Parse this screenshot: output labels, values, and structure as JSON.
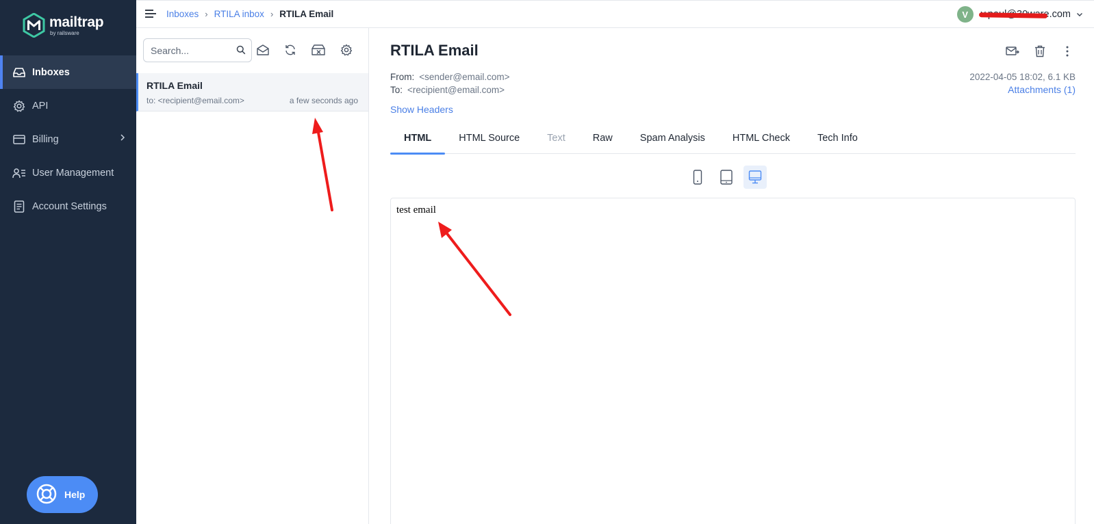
{
  "brand": {
    "name": "mailtrap",
    "sub": "by railsware",
    "accent": "#4c8cf5",
    "sidebar_bg": "#1c2a3e"
  },
  "sidebar": {
    "items": [
      {
        "label": "Inboxes",
        "icon": "inbox-icon",
        "active": true
      },
      {
        "label": "API",
        "icon": "gear-icon"
      },
      {
        "label": "Billing",
        "icon": "credit-card-icon",
        "has_submenu": true
      },
      {
        "label": "User Management",
        "icon": "users-icon"
      },
      {
        "label": "Account Settings",
        "icon": "document-icon"
      }
    ],
    "help_label": "Help"
  },
  "topbar": {
    "breadcrumb": [
      "Inboxes",
      "RTILA inbox",
      "RTILA Email"
    ],
    "avatar_letter": "V",
    "user_email": "v.paul@30ware.com"
  },
  "list": {
    "search_placeholder": "Search...",
    "tools": [
      "mark-read-icon",
      "refresh-icon",
      "clear-inbox-icon",
      "settings-icon"
    ],
    "messages": [
      {
        "subject": "RTILA Email",
        "to": "to: <recipient@email.com>",
        "time": "a few seconds ago",
        "selected": true
      }
    ]
  },
  "message": {
    "title": "RTILA Email",
    "from_label": "From:",
    "from": "<sender@email.com>",
    "to_label": "To:",
    "to": "<recipient@email.com>",
    "date_size": "2022-04-05 18:02, 6.1 KB",
    "attachments": "Attachments (1)",
    "show_headers": "Show Headers",
    "actions": [
      "forward-icon",
      "trash-icon",
      "more-icon"
    ],
    "tabs": [
      {
        "label": "HTML",
        "active": true
      },
      {
        "label": "HTML Source"
      },
      {
        "label": "Text",
        "disabled": true
      },
      {
        "label": "Raw"
      },
      {
        "label": "Spam Analysis"
      },
      {
        "label": "HTML Check"
      },
      {
        "label": "Tech Info"
      }
    ],
    "device_modes": [
      "mobile-icon",
      "tablet-icon",
      "desktop-icon"
    ],
    "body": "test email"
  }
}
